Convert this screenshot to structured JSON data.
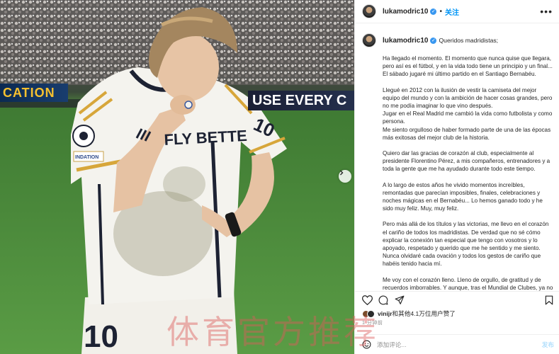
{
  "photo": {
    "adboard_left": "CATION",
    "adboard_right": "USE EVERY C",
    "jersey_number": "10",
    "jersey_sponsor": "FLY BETTE",
    "patch_text": "INDATION"
  },
  "header": {
    "username": "lukamodric10",
    "separator": "•",
    "follow_label": "关注",
    "more_label": "•••"
  },
  "caption": {
    "username": "lukamodric10",
    "title": "Queridos madridistas;",
    "paragraphs": [
      "Ha llegado el momento. El momento que nunca quise que llegara, pero así es el fútbol, y en la vida todo tiene un principio y un final... El sábado jugaré mi último partido en el Santiago Bernabéu.",
      "Llegué en 2012 con la ilusión de vestir la camiseta del mejor equipo del mundo y con la ambición de hacer cosas grandes, pero no me podía imaginar lo que vino después.\nJugar en el Real Madrid me cambió la vida como futbolista y como persona.\nMe siento orgulloso de haber formado parte de una de las épocas más exitosas del mejor club de la historia.",
      "Quiero dar las gracias de corazón al club, especialmente al presidente Florentino Pérez, a mis compañeros, entrenadores y a toda la gente que me ha ayudado durante todo este tiempo.",
      "A lo largo de estos años he vivido momentos increíbles, remontadas que parecían imposibles, finales, celebraciones y noches mágicas en el Bernabéu... Lo hemos ganado todo y he sido muy feliz. Muy, muy feliz.",
      "Pero más allá de los títulos y las victorias, me llevo en el corazón el cariño de todos los madridistas. De verdad que no sé cómo explicar la conexión tan especial que tengo con vosotros y lo apoyado, respetado y querido que me he sentido y me siento. Nunca olvidaré cada ovación y todos los gestos de cariño que habéis tenido hacia mí.",
      "Me voy con el corazón lleno. Lleno de orgullo, de gratitud y de recuerdos imborrables. Y aunque, tras el Mundial de Clubes, ya no vaya a vestir más esta camiseta sobre el césped, yo siempre seré"
    ]
  },
  "likes": {
    "user": "vinijr",
    "text": "和其他4.1万位用户赞了"
  },
  "time": "1 分钟前",
  "comment": {
    "placeholder": "添加评论...",
    "post_label": "发布"
  },
  "watermark": "体育官方推荐",
  "colors": {
    "link_blue": "#0095f6",
    "verified_blue": "#3897f0",
    "post_disabled": "#b2dffc",
    "watermark_red": "#dc5a5a"
  },
  "icons": [
    "verified-badge-icon",
    "more-options-icon",
    "heart-icon",
    "comment-icon",
    "share-icon",
    "bookmark-icon",
    "chevron-right-icon",
    "emoji-icon"
  ]
}
